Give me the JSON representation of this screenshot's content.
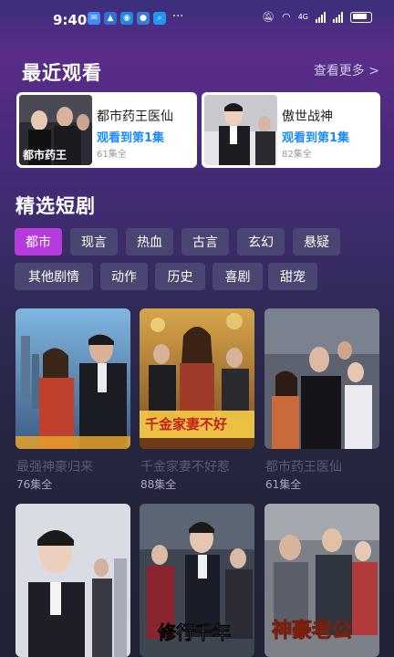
{
  "status_bar": {
    "time": "9:40",
    "network_label": "4G"
  },
  "recent": {
    "title": "最近观看",
    "see_more": "查看更多 >",
    "items": [
      {
        "title": "都市药王医仙",
        "progress": "观看到第1集",
        "count": "61集全"
      },
      {
        "title": "傲世战神",
        "progress": "观看到第1集",
        "count": "82集全"
      }
    ]
  },
  "featured": {
    "title": "精选短剧",
    "categories": [
      "都市",
      "现言",
      "热血",
      "古言",
      "玄幻",
      "悬疑",
      "其他剧情",
      "动作",
      "历史",
      "喜剧",
      "甜宠"
    ],
    "selected_category": "都市",
    "dramas": [
      {
        "title": "最强神豪归来",
        "count": "76集全"
      },
      {
        "title": "千金家妻不好惹",
        "count": "88集全"
      },
      {
        "title": "都市药王医仙",
        "count": "61集全"
      },
      {
        "title": "",
        "count": ""
      },
      {
        "title": "",
        "count": ""
      },
      {
        "title": "",
        "count": ""
      }
    ],
    "poster_texts": [
      "千金家妻不好",
      "修行千年",
      "神豪老公"
    ]
  }
}
